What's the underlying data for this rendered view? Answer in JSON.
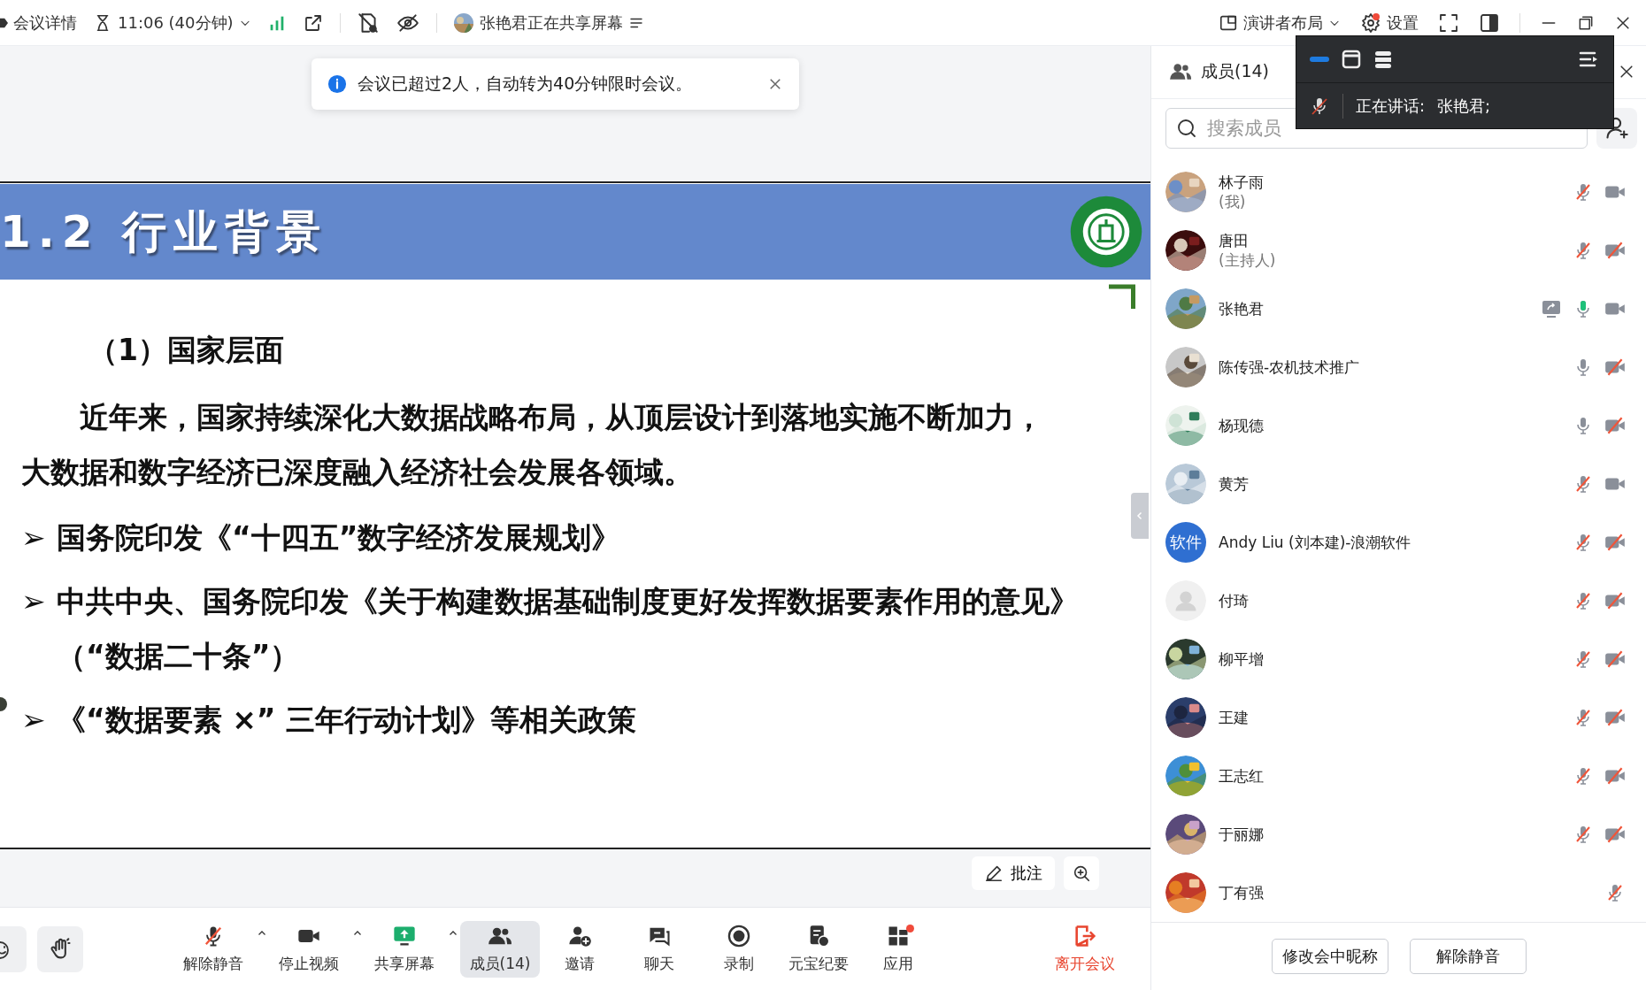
{
  "top_bar": {
    "details": "会议详情",
    "timer": "11:06 (40分钟)",
    "sharing_notice": "张艳君正在共享屏幕",
    "layout": "演讲者布局",
    "settings": {
      "label": "设置",
      "notification": true
    }
  },
  "toast": {
    "message": "会议已超过2人，自动转为40分钟限时会议。"
  },
  "slide": {
    "title": "1.2 行业背景",
    "heading": "（1）国家层面",
    "paragraph": "近年来，国家持续深化大数据战略布局，从顶层设计到落地实施不断加力，大数据和数字经济已深度融入经济社会发展各领域。",
    "bullets": [
      {
        "marker": "➢",
        "text": "国务院印发《“十四五”数字经济发展规划》"
      },
      {
        "marker": "➢",
        "text": "中共中央、国务院印发《关于构建数据基础制度更好发挥数据要素作用的意见》（“数据二十条”）"
      },
      {
        "marker": "➢",
        "text": "《“数据要素 ×” 三年行动计划》等相关政策"
      }
    ]
  },
  "annotate_button": "批注",
  "toolbar": [
    {
      "label": "解除静音",
      "menu": true,
      "selected": false,
      "notification": false,
      "kind": "normal"
    },
    {
      "label": "停止视频",
      "menu": true,
      "selected": false,
      "notification": false,
      "kind": "normal"
    },
    {
      "label": "共享屏幕",
      "menu": true,
      "selected": false,
      "notification": false,
      "kind": "normal"
    },
    {
      "label": "成员(14)",
      "menu": false,
      "selected": true,
      "notification": false,
      "kind": "normal"
    },
    {
      "label": "邀请",
      "menu": false,
      "selected": false,
      "notification": false,
      "kind": "normal"
    },
    {
      "label": "聊天",
      "menu": false,
      "selected": false,
      "notification": false,
      "kind": "normal"
    },
    {
      "label": "录制",
      "menu": false,
      "selected": false,
      "notification": false,
      "kind": "normal"
    },
    {
      "label": "元宝纪要",
      "menu": false,
      "selected": false,
      "notification": false,
      "kind": "normal"
    },
    {
      "label": "应用",
      "menu": false,
      "selected": false,
      "notification": true,
      "kind": "normal"
    },
    {
      "label": "离开会议",
      "menu": false,
      "selected": false,
      "notification": false,
      "kind": "leave"
    }
  ],
  "members_panel": {
    "title": "成员(14)",
    "search": {
      "placeholder": "搜索成员"
    },
    "members": [
      {
        "name": "林子雨",
        "role": "(我)",
        "muted": true,
        "speaking": false,
        "video": true,
        "sharing": false
      },
      {
        "name": "唐田",
        "role": "(主持人)",
        "muted": true,
        "speaking": false,
        "video": false,
        "sharing": false
      },
      {
        "name": "张艳君",
        "muted": false,
        "speaking": true,
        "video": true,
        "sharing": true
      },
      {
        "name": "陈传强-农机技术推广",
        "muted": false,
        "speaking": false,
        "video": false,
        "sharing": false
      },
      {
        "name": "杨现德",
        "muted": false,
        "speaking": false,
        "video": false,
        "sharing": false
      },
      {
        "name": "黄芳",
        "muted": true,
        "speaking": false,
        "video": true,
        "sharing": false
      },
      {
        "name": "Andy Liu (刘本建)-浪潮软件",
        "kind": "initials",
        "avatar_text": "软件",
        "muted": true,
        "speaking": false,
        "video": false,
        "sharing": false
      },
      {
        "name": "付琦",
        "kind": "placeholder",
        "muted": true,
        "speaking": false,
        "video": false,
        "sharing": false
      },
      {
        "name": "柳平增",
        "muted": true,
        "speaking": false,
        "video": false,
        "sharing": false
      },
      {
        "name": "王建",
        "muted": true,
        "speaking": false,
        "video": false,
        "sharing": false
      },
      {
        "name": "王志红",
        "muted": true,
        "speaking": false,
        "video": false,
        "sharing": false
      },
      {
        "name": "于丽娜",
        "muted": true,
        "speaking": false,
        "video": false,
        "sharing": false
      },
      {
        "name": "丁有强",
        "muted": true,
        "speaking": false,
        "sharing": false
      }
    ],
    "buttons": [
      "修改会中昵称",
      "解除静音"
    ]
  },
  "speaker_popup": {
    "label": "正在讲话:",
    "speaker": "张艳君;"
  }
}
